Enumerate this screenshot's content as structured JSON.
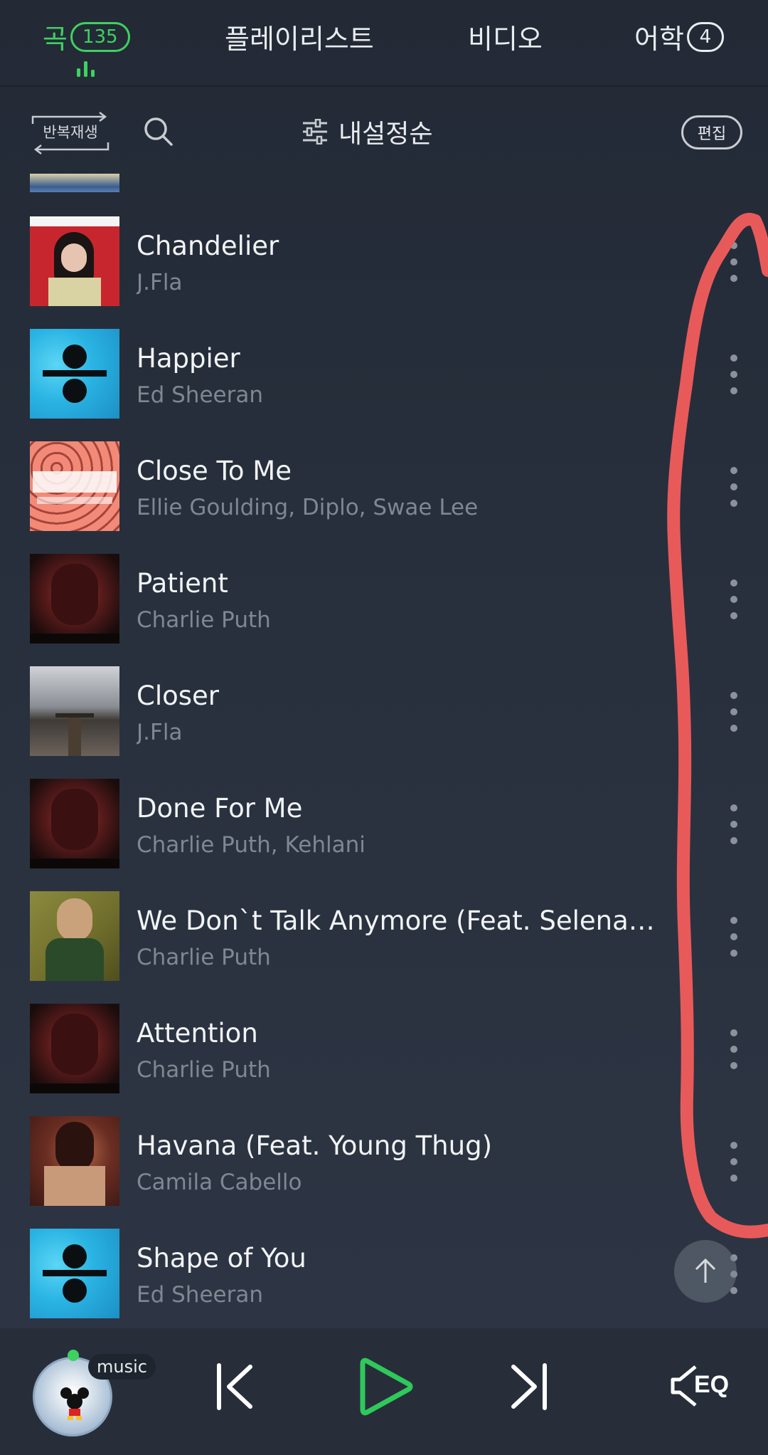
{
  "tabs": [
    {
      "label": "곡",
      "badge": "135",
      "active": true
    },
    {
      "label": "플레이리스트"
    },
    {
      "label": "비디오"
    },
    {
      "label": "어학",
      "badge": "4"
    }
  ],
  "toolbar": {
    "repeat_label": "반복재생",
    "sort_label": "내설정순",
    "edit_label": "편집"
  },
  "songs": [
    {
      "title": "Chandelier",
      "artist": "J.Fla",
      "art": "chandelier"
    },
    {
      "title": "Happier",
      "artist": "Ed Sheeran",
      "art": "divide"
    },
    {
      "title": "Close To Me",
      "artist": "Ellie Goulding, Diplo, Swae Lee",
      "art": "close"
    },
    {
      "title": "Patient",
      "artist": "Charlie Puth",
      "art": "charlie"
    },
    {
      "title": "Closer",
      "artist": "J.Fla",
      "art": "closer"
    },
    {
      "title": "Done For Me",
      "artist": "Charlie Puth, Kehlani",
      "art": "charlie"
    },
    {
      "title": "We Don`t Talk Anymore (Feat. Selena G...",
      "artist": "Charlie Puth",
      "art": "wedont"
    },
    {
      "title": "Attention",
      "artist": "Charlie Puth",
      "art": "charlie"
    },
    {
      "title": "Havana (Feat. Young Thug)",
      "artist": "Camila Cabello",
      "art": "havana"
    },
    {
      "title": "Shape of You",
      "artist": "Ed Sheeran",
      "art": "divide"
    }
  ],
  "player": {
    "source_label": "music",
    "eq_label": "EQ"
  },
  "colors": {
    "accent": "#3ed160",
    "annotation": "#e85a5a"
  }
}
